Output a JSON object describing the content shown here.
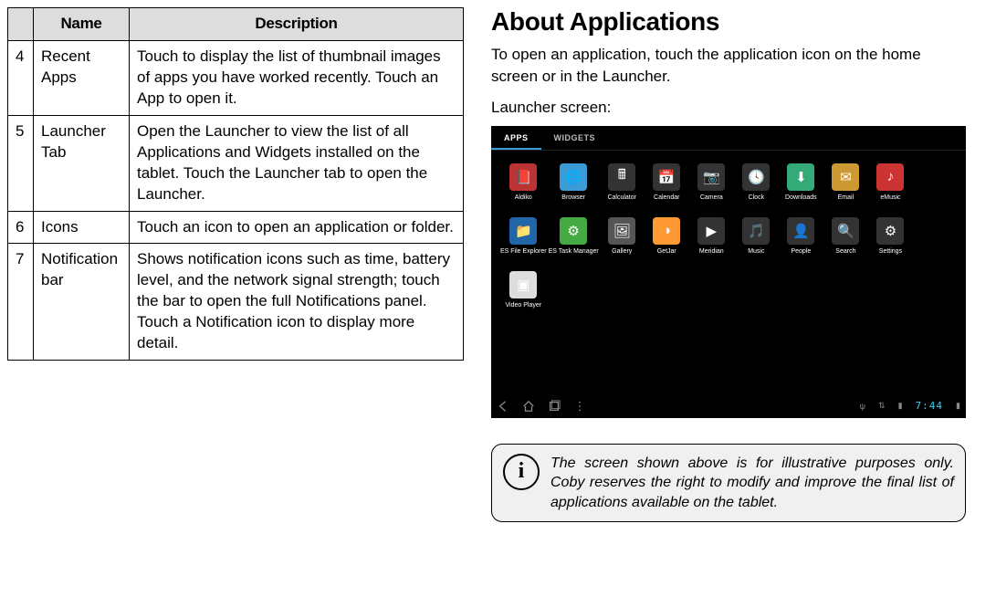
{
  "table": {
    "headers": {
      "name": "Name",
      "description": "Description"
    },
    "rows": [
      {
        "num": "4",
        "name": "Recent Apps",
        "desc": "Touch to display the list of thumbnail images of apps you have worked recently. Touch an App to open it."
      },
      {
        "num": "5",
        "name": "Launcher Tab",
        "desc": "Open the Launcher to view the list of all Applications and Widgets installed on the tablet. Touch the Launcher tab to open the Launcher."
      },
      {
        "num": "6",
        "name": "Icons",
        "desc": "Touch an icon to open an application or folder."
      },
      {
        "num": "7",
        "name": "Notification bar",
        "desc": "Shows notification icons such as time, battery level, and the network signal strength; touch the bar to open the full Notifications panel. Touch a Notification icon to display more detail."
      }
    ]
  },
  "heading": "About Applications",
  "intro": "To open an application, touch the application icon on the home screen or in the Launcher.",
  "label": "Launcher screen:",
  "tablet": {
    "tabs": {
      "apps": "APPS",
      "widgets": "WIDGETS"
    },
    "apps": [
      {
        "label": "Aldiko",
        "bg": "#b33",
        "glyph": "📕"
      },
      {
        "label": "Browser",
        "bg": "#3a9bd6",
        "glyph": "🌐"
      },
      {
        "label": "Calculator",
        "bg": "#333",
        "glyph": "🖩"
      },
      {
        "label": "Calendar",
        "bg": "#333",
        "glyph": "📅"
      },
      {
        "label": "Camera",
        "bg": "#333",
        "glyph": "📷"
      },
      {
        "label": "Clock",
        "bg": "#333",
        "glyph": "🕓"
      },
      {
        "label": "Downloads",
        "bg": "#3a7",
        "glyph": "⬇"
      },
      {
        "label": "Email",
        "bg": "#c93",
        "glyph": "✉"
      },
      {
        "label": "eMusic",
        "bg": "#c33",
        "glyph": "♪"
      },
      {
        "label": "",
        "bg": "transparent",
        "glyph": ""
      },
      {
        "label": "ES File Explorer",
        "bg": "#26a",
        "glyph": "📁"
      },
      {
        "label": "ES Task Manager",
        "bg": "#4a4",
        "glyph": "⚙"
      },
      {
        "label": "Gallery",
        "bg": "#555",
        "glyph": "🖼"
      },
      {
        "label": "GetJar",
        "bg": "#f93",
        "glyph": "◑"
      },
      {
        "label": "Meridian",
        "bg": "#333",
        "glyph": "▶"
      },
      {
        "label": "Music",
        "bg": "#333",
        "glyph": "🎵"
      },
      {
        "label": "People",
        "bg": "#333",
        "glyph": "👤"
      },
      {
        "label": "Search",
        "bg": "#333",
        "glyph": "🔍"
      },
      {
        "label": "Settings",
        "bg": "#333",
        "glyph": "⚙"
      },
      {
        "label": "",
        "bg": "transparent",
        "glyph": ""
      },
      {
        "label": "Video Player",
        "bg": "#ddd",
        "glyph": "▣"
      }
    ],
    "time": "7:44"
  },
  "info": "The screen shown above is for illustrative purposes only. Coby reserves the right to modify  and improve the final list of applications available on the tablet."
}
